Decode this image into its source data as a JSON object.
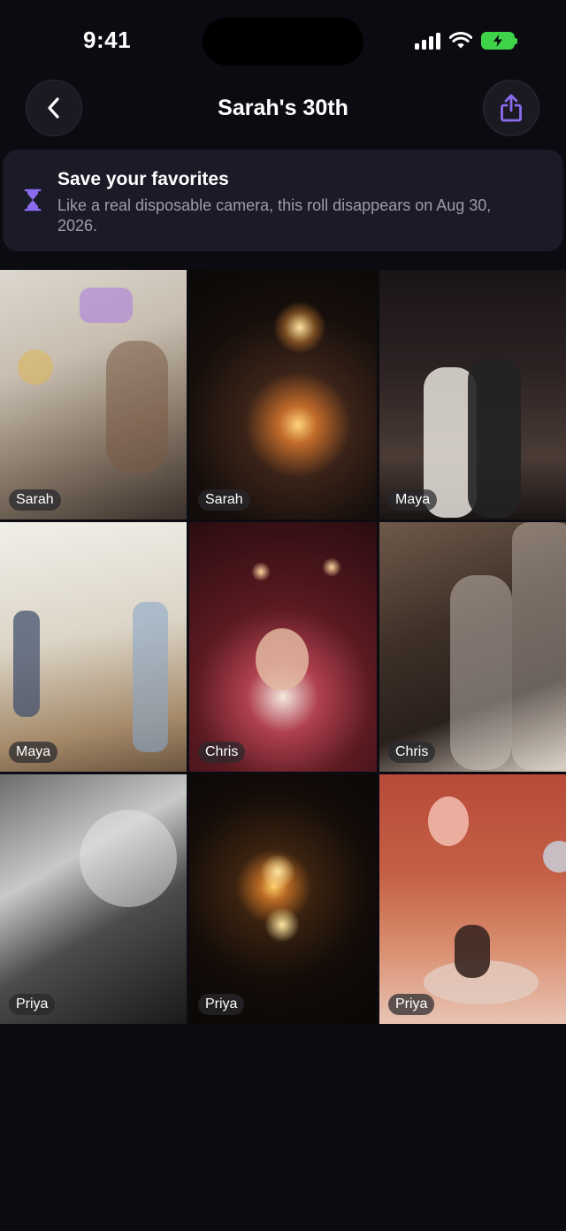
{
  "status_bar": {
    "time": "9:41"
  },
  "nav": {
    "title": "Sarah's 30th",
    "back_icon": "chevron-left-icon",
    "share_icon": "share-icon",
    "share_color": "#8b6cf0"
  },
  "banner": {
    "icon": "hourglass-icon",
    "title": "Save your favorites",
    "text": "Like a real disposable camera, this roll disappears on Aug 30, 2026."
  },
  "photos": [
    {
      "author": "Sarah"
    },
    {
      "author": "Sarah"
    },
    {
      "author": "Maya"
    },
    {
      "author": "Maya"
    },
    {
      "author": "Chris"
    },
    {
      "author": "Chris"
    },
    {
      "author": "Priya"
    },
    {
      "author": "Priya"
    },
    {
      "author": "Priya"
    }
  ],
  "colors": {
    "background": "#0c0b12",
    "banner_bg": "#1b1a27",
    "accent": "#8b6cf0",
    "battery": "#3fd34a"
  }
}
